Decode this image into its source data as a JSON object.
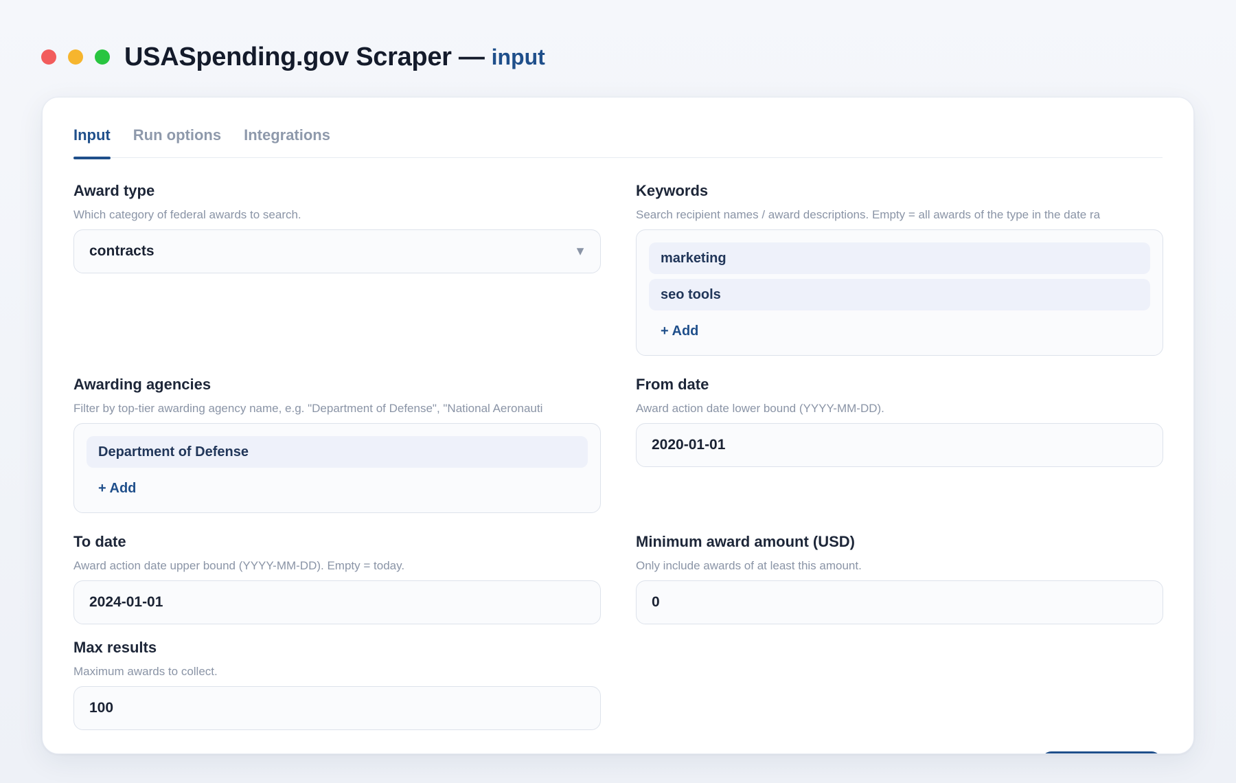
{
  "window": {
    "title": "USASpending.gov Scraper —",
    "subtitle": "input",
    "dots": [
      "#f25c5c",
      "#f6b52e",
      "#29c540"
    ]
  },
  "tabs": [
    {
      "label": "Input",
      "active": true
    },
    {
      "label": "Run options",
      "active": false
    },
    {
      "label": "Integrations",
      "active": false
    }
  ],
  "fields": {
    "award_type": {
      "label": "Award type",
      "help": "Which category of federal awards to search.",
      "value": "contracts",
      "arrow": "▼"
    },
    "keywords": {
      "label": "Keywords",
      "help": "Search recipient names / award descriptions. Empty = all awards of the type in the date ra",
      "items": [
        "marketing",
        "seo tools"
      ],
      "add_label": "+ Add"
    },
    "agencies": {
      "label": "Awarding agencies",
      "help": "Filter by top-tier awarding agency name, e.g. \"Department of Defense\", \"National Aeronauti",
      "items": [
        "Department of Defense"
      ],
      "add_label": "+ Add"
    },
    "from_date": {
      "label": "From date",
      "help": "Award action date lower bound (YYYY-MM-DD).",
      "value": "2020-01-01"
    },
    "to_date": {
      "label": "To date",
      "help": "Award action date upper bound (YYYY-MM-DD). Empty = today.",
      "value": "2024-01-01"
    },
    "min_amount": {
      "label": "Minimum award amount (USD)",
      "help": "Only include awards of at least this amount.",
      "value": "0"
    },
    "max_results": {
      "label": "Max results",
      "help": "Maximum awards to collect.",
      "value": "100"
    }
  }
}
